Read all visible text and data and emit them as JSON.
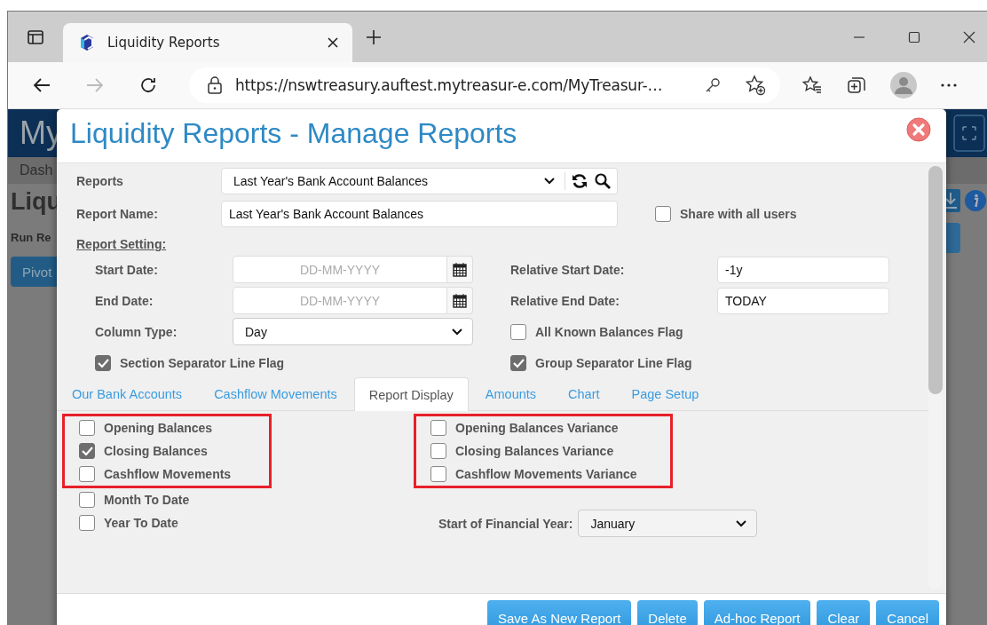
{
  "browser": {
    "tab_title": "Liquidity Reports",
    "url": "https://nswtreasury.auftest.mytreasur-e.com/MyTreasur-…"
  },
  "background_page": {
    "brand": "My",
    "nav_item": "Dash",
    "heading": "Liqu",
    "label": "Run Re",
    "button": "Pivot"
  },
  "dialog": {
    "title": "Liquidity Reports - Manage Reports",
    "reports": {
      "label": "Reports",
      "value": "Last Year's Bank Account Balances"
    },
    "report_name": {
      "label": "Report Name:",
      "value": "Last Year's Bank Account Balances"
    },
    "share": {
      "label": "Share with all users",
      "checked": false
    },
    "section_heading": "Report Setting:",
    "dates": [
      {
        "label": "Start Date:",
        "placeholder": "DD-MM-YYYY",
        "relative_label": "Relative Start Date:",
        "relative_value": "-1y"
      },
      {
        "label": "End Date:",
        "placeholder": "DD-MM-YYYY",
        "relative_label": "Relative End Date:",
        "relative_value": "TODAY"
      }
    ],
    "column_type": {
      "label": "Column Type:",
      "value": "Day"
    },
    "all_known_flag": {
      "label": "All Known Balances Flag",
      "checked": false
    },
    "section_separator_flag": {
      "label": "Section Separator Line Flag",
      "checked": true
    },
    "group_separator_flag": {
      "label": "Group Separator Line Flag",
      "checked": true
    },
    "tabs": [
      {
        "label": "Our Bank Accounts",
        "selected": false
      },
      {
        "label": "Cashflow Movements",
        "selected": false
      },
      {
        "label": "Report Display",
        "selected": true
      },
      {
        "label": "Amounts",
        "selected": false
      },
      {
        "label": "Chart",
        "selected": false
      },
      {
        "label": "Page Setup",
        "selected": false
      }
    ],
    "left_groups": [
      {
        "highlighted": true,
        "options": [
          {
            "label": "Opening Balances",
            "checked": false
          },
          {
            "label": "Closing Balances",
            "checked": true
          },
          {
            "label": "Cashflow Movements",
            "checked": false
          }
        ]
      },
      {
        "highlighted": false,
        "options": [
          {
            "label": "Month To Date",
            "checked": false
          },
          {
            "label": "Year To Date",
            "checked": false
          }
        ]
      }
    ],
    "right_groups": [
      {
        "highlighted": true,
        "options": [
          {
            "label": "Opening Balances Variance",
            "checked": false
          },
          {
            "label": "Closing Balances Variance",
            "checked": false
          },
          {
            "label": "Cashflow Movements Variance",
            "checked": false
          }
        ]
      }
    ],
    "financial_year": {
      "label": "Start of Financial Year:",
      "value": "January"
    },
    "buttons": [
      "Save As New Report",
      "Delete",
      "Ad-hoc Report",
      "Clear",
      "Cancel"
    ]
  }
}
